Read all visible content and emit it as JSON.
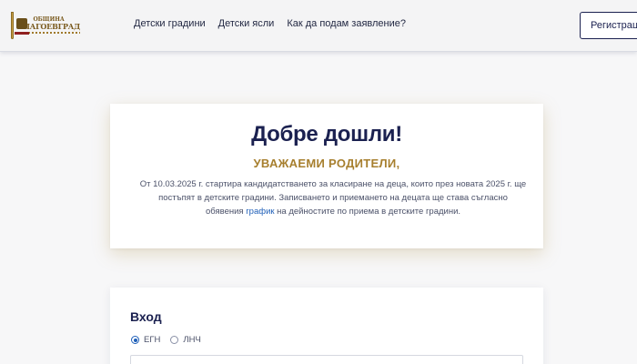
{
  "header": {
    "logo": {
      "line1": "ОБЩИНА",
      "line2": "БЛАГОЕВГРАД",
      "icon": "coat-of-arms-icon"
    },
    "nav": [
      {
        "label": "Детски градини"
      },
      {
        "label": "Детски ясли"
      },
      {
        "label": "Как да подам заявление?"
      }
    ],
    "register_label": "Регистрация"
  },
  "welcome": {
    "title": "Добре дошли!",
    "subtitle": "УВАЖАЕМИ РОДИТЕЛИ,",
    "text_part1": "От 10.03.2025 г. стартира кандидатстването за класиране на деца, които през новата 2025 г. ще постъпят в детските градини. Записването и приемането на децата ще става съгласно обявения ",
    "link_label": "график",
    "text_part2": " на дейностите по приема в детските градини."
  },
  "login": {
    "title": "Вход",
    "options": [
      {
        "label": "ЕГН",
        "selected": true
      },
      {
        "label": "ЛНЧ",
        "selected": false
      }
    ],
    "input_value": "",
    "input_placeholder": ""
  },
  "colors": {
    "navy": "#1b2150",
    "gold": "#a77f2e",
    "link": "#1f5fb8"
  }
}
